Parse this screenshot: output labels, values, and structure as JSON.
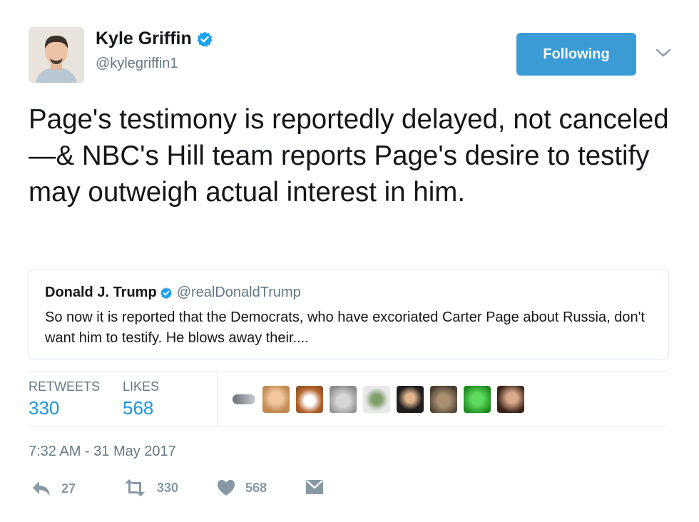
{
  "author": {
    "name": "Kyle Griffin",
    "handle": "@kylegriffin1",
    "verified": true
  },
  "follow_button": {
    "label": "Following",
    "color": "#3a9bd5"
  },
  "tweet": {
    "text": "Page's testimony is reportedly delayed, not canceled—& NBC's Hill team reports Page's desire to testify may outweigh actual interest in him."
  },
  "quoted_tweet": {
    "name": "Donald J. Trump",
    "handle": "@realDonaldTrump",
    "verified": true,
    "text": "So now it is reported that the Democrats, who have excoriated Carter Page about Russia, don't want him to testify. He blows away their...."
  },
  "stats": {
    "retweets_label": "RETWEETS",
    "retweets_value": "330",
    "likes_label": "LIKES",
    "likes_value": "568"
  },
  "timestamp": "7:32 AM - 31 May 2017",
  "actions": {
    "reply_count": "27",
    "retweet_count": "330",
    "like_count": "568"
  },
  "icons": {
    "verified": "verified-badge-icon",
    "caret": "chevron-down-icon",
    "reply": "reply-icon",
    "retweet": "retweet-icon",
    "like": "heart-icon",
    "dm": "envelope-icon"
  },
  "colors": {
    "accent": "#1b95e0",
    "muted": "#657786",
    "action_gray": "#8899a6"
  }
}
